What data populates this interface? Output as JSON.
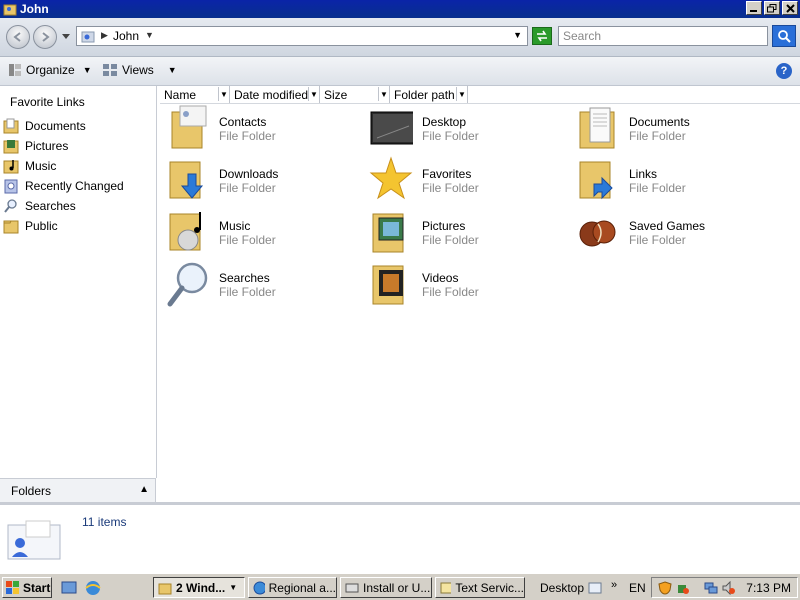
{
  "window": {
    "title": "John"
  },
  "address": {
    "crumb": "John",
    "search_placeholder": "Search"
  },
  "toolbar": {
    "organize": "Organize",
    "views": "Views",
    "help": "?"
  },
  "nav": {
    "header": "Favorite Links",
    "items": [
      {
        "label": "Documents",
        "icon": "documents-folder-icon"
      },
      {
        "label": "Pictures",
        "icon": "pictures-folder-icon"
      },
      {
        "label": "Music",
        "icon": "music-folder-icon"
      },
      {
        "label": "Recently Changed",
        "icon": "recently-changed-icon"
      },
      {
        "label": "Searches",
        "icon": "searches-icon"
      },
      {
        "label": "Public",
        "icon": "public-folder-icon"
      }
    ],
    "folders_label": "Folders"
  },
  "columns": [
    "Name",
    "Date modified",
    "Size",
    "Folder path"
  ],
  "tiles": [
    {
      "name": "Contacts",
      "type": "File Folder",
      "icon": "contacts-folder-icon"
    },
    {
      "name": "Desktop",
      "type": "File Folder",
      "icon": "desktop-folder-icon"
    },
    {
      "name": "Documents",
      "type": "File Folder",
      "icon": "documents-folder-icon"
    },
    {
      "name": "Downloads",
      "type": "File Folder",
      "icon": "downloads-folder-icon"
    },
    {
      "name": "Favorites",
      "type": "File Folder",
      "icon": "favorites-star-icon"
    },
    {
      "name": "Links",
      "type": "File Folder",
      "icon": "links-folder-icon"
    },
    {
      "name": "Music",
      "type": "File Folder",
      "icon": "music-folder-icon"
    },
    {
      "name": "Pictures",
      "type": "File Folder",
      "icon": "pictures-folder-icon"
    },
    {
      "name": "Saved Games",
      "type": "File Folder",
      "icon": "saved-games-icon"
    },
    {
      "name": "Searches",
      "type": "File Folder",
      "icon": "searches-magnifier-icon"
    },
    {
      "name": "Videos",
      "type": "File Folder",
      "icon": "videos-folder-icon"
    }
  ],
  "details": {
    "count": "11 items"
  },
  "taskbar": {
    "start": "Start",
    "tasks": [
      {
        "label": "2 Wind...",
        "active": true
      },
      {
        "label": "Regional a...",
        "active": false
      },
      {
        "label": "Install or U...",
        "active": false
      },
      {
        "label": "Text Servic...",
        "active": false
      }
    ],
    "desktop": "Desktop",
    "lang": "EN",
    "clock": "7:13 PM"
  },
  "colors": {
    "title_bar": "#0a24a8",
    "folder": "#e8c66a",
    "type_text": "#888888"
  }
}
